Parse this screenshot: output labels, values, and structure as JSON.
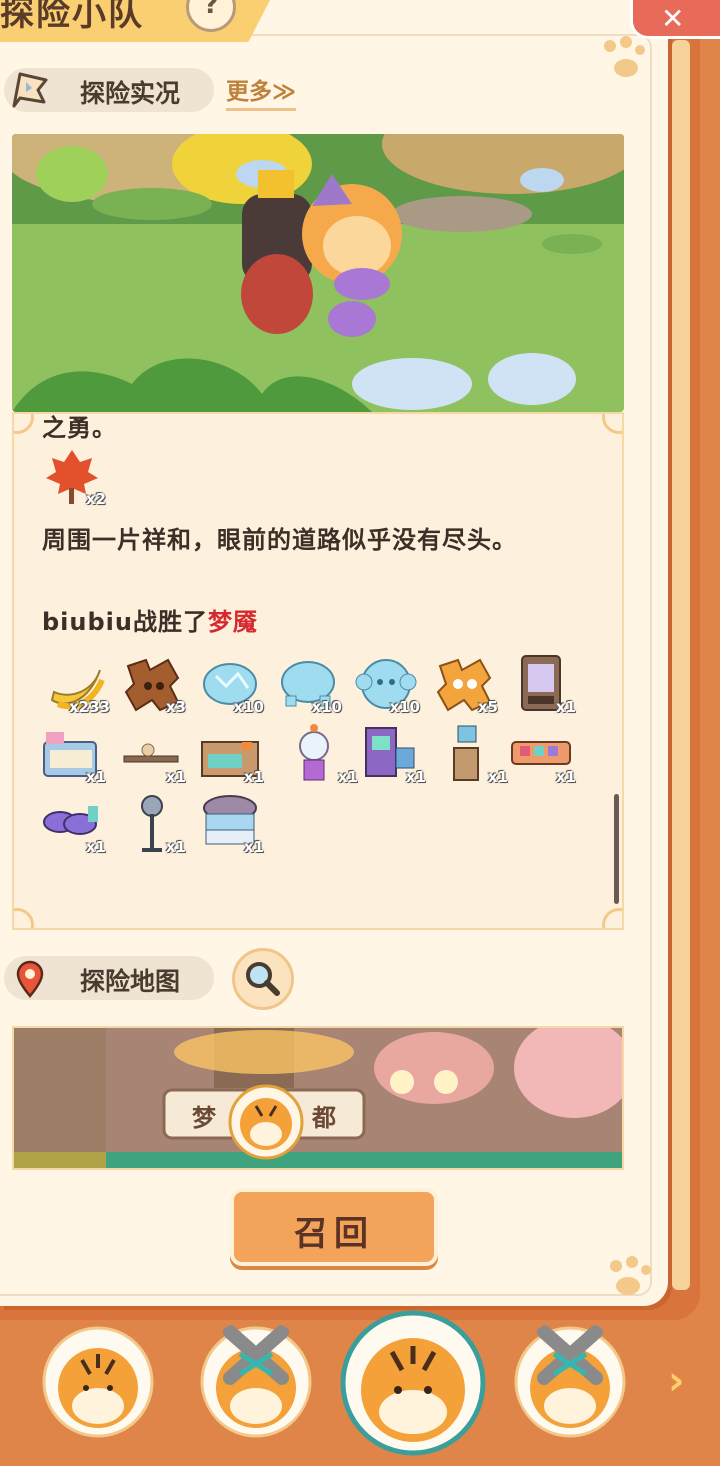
{
  "header": {
    "title": "探险小队",
    "help_label": "?",
    "close_label": "✕"
  },
  "live": {
    "label": "探险实况",
    "more_label": "更多≫"
  },
  "log": {
    "fragment": "之勇。",
    "first_items": [
      {
        "icon": "maple-leaf-icon",
        "qty": "x2"
      }
    ],
    "narration": "周围一片祥和，眼前的道路似乎没有尽头。",
    "battle_prefix": "biubiu战胜了",
    "battle_enemy": "梦魇",
    "rewards": [
      {
        "icon": "banana-icon",
        "qty": "x233"
      },
      {
        "icon": "bear-puzzle-icon",
        "qty": "x3"
      },
      {
        "icon": "ice-crystal-pig-icon",
        "qty": "x10"
      },
      {
        "icon": "ice-crystal-turtle-icon",
        "qty": "x10"
      },
      {
        "icon": "ice-crystal-monkey-icon",
        "qty": "x10"
      },
      {
        "icon": "lion-puzzle-icon",
        "qty": "x5"
      },
      {
        "icon": "vending-machine-icon",
        "qty": "x1"
      },
      {
        "icon": "bed-icon",
        "qty": "x1"
      },
      {
        "icon": "shelf-icon",
        "qty": "x1"
      },
      {
        "icon": "cabinet-icon",
        "qty": "x1"
      },
      {
        "icon": "gumball-machine-icon",
        "qty": "x1"
      },
      {
        "icon": "arcade-machine-icon",
        "qty": "x1"
      },
      {
        "icon": "pedestal-display-icon",
        "qty": "x1"
      },
      {
        "icon": "counter-icon",
        "qty": "x1"
      },
      {
        "icon": "purple-sofa-icon",
        "qty": "x1"
      },
      {
        "icon": "standing-fan-icon",
        "qty": "x1"
      },
      {
        "icon": "cloud-table-icon",
        "qty": "x1"
      }
    ]
  },
  "map": {
    "label": "探险地图",
    "location_sign": "梦魇之都"
  },
  "recall_label": "召回",
  "team": [
    {
      "name": "tiger-1",
      "injured": false,
      "selected": false
    },
    {
      "name": "tiger-2",
      "injured": true,
      "selected": false
    },
    {
      "name": "tiger-3",
      "injured": false,
      "selected": true
    },
    {
      "name": "tiger-4",
      "injured": true,
      "selected": false
    }
  ],
  "next_label": "›"
}
